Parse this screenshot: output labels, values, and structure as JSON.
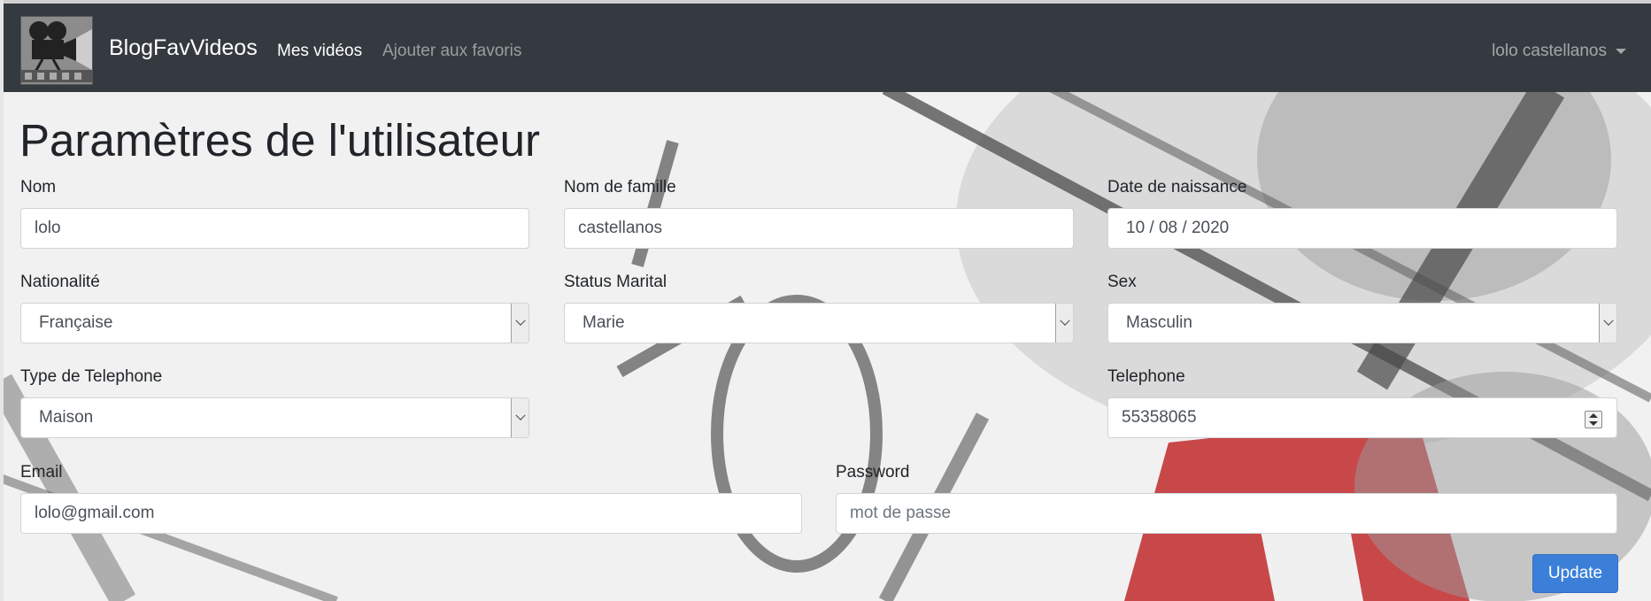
{
  "navbar": {
    "brand": "BlogFavVideos",
    "links": [
      {
        "label": "Mes vidéos",
        "active": true
      },
      {
        "label": "Ajouter aux favoris",
        "active": false
      }
    ],
    "user": "lolo castellanos"
  },
  "page": {
    "title": "Paramètres de l'utilisateur"
  },
  "form": {
    "nom": {
      "label": "Nom",
      "value": "lolo"
    },
    "nom_famille": {
      "label": "Nom de famille",
      "value": "castellanos"
    },
    "date_naissance": {
      "label": "Date de naissance",
      "value": "10 / 08 / 2020"
    },
    "nationalite": {
      "label": "Nationalité",
      "value": "Française"
    },
    "status_marital": {
      "label": "Status Marital",
      "value": "Marie"
    },
    "sex": {
      "label": "Sex",
      "value": "Masculin"
    },
    "type_telephone": {
      "label": "Type de Telephone",
      "value": "Maison"
    },
    "telephone": {
      "label": "Telephone",
      "value": "55358065"
    },
    "email": {
      "label": "Email",
      "value": "lolo@gmail.com"
    },
    "password": {
      "label": "Password",
      "placeholder": "mot de passe"
    },
    "update_label": "Update"
  },
  "colors": {
    "navbar": "#343a40",
    "primary": "#3b7fd9"
  }
}
